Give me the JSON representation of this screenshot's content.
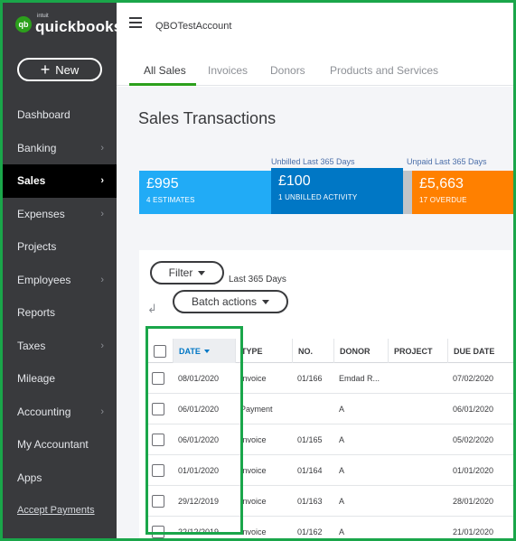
{
  "logo": {
    "mark": "qb",
    "small": "intuit",
    "name": "quickbooks"
  },
  "new_button": {
    "plus": "+",
    "label": "New"
  },
  "nav": [
    {
      "label": "Dashboard",
      "chevron": false,
      "active": false
    },
    {
      "label": "Banking",
      "chevron": true,
      "active": false
    },
    {
      "label": "Sales",
      "chevron": true,
      "active": true
    },
    {
      "label": "Expenses",
      "chevron": true,
      "active": false
    },
    {
      "label": "Projects",
      "chevron": false,
      "active": false
    },
    {
      "label": "Employees",
      "chevron": true,
      "active": false
    },
    {
      "label": "Reports",
      "chevron": false,
      "active": false
    },
    {
      "label": "Taxes",
      "chevron": true,
      "active": false
    },
    {
      "label": "Mileage",
      "chevron": false,
      "active": false
    },
    {
      "label": "Accounting",
      "chevron": true,
      "active": false
    },
    {
      "label": "My Accountant",
      "chevron": false,
      "active": false
    },
    {
      "label": "Apps",
      "chevron": false,
      "active": false
    },
    {
      "label": "Accept Payments",
      "chevron": false,
      "active": false,
      "link": true
    }
  ],
  "chevron_glyph": "›",
  "header": {
    "company": "QBOTestAccount"
  },
  "tabs": [
    {
      "label": "All Sales",
      "active": true
    },
    {
      "label": "Invoices",
      "active": false
    },
    {
      "label": "Donors",
      "active": false
    },
    {
      "label": "Products and Services",
      "active": false
    }
  ],
  "page_title": "Sales Transactions",
  "money_bar": {
    "unbilled_caption": "Unbilled Last 365 Days",
    "unpaid_caption": "Unpaid Last 365 Days",
    "estimates": {
      "amount": "£995",
      "label": "4 ESTIMATES",
      "color": "#21abf6"
    },
    "unbilled": {
      "amount": "£100",
      "label": "1 UNBILLED ACTIVITY",
      "color": "#0077c5"
    },
    "overdue": {
      "amount": "£5,663",
      "label": "17 OVERDUE",
      "color": "#ff8000"
    }
  },
  "filter": {
    "label": "Filter",
    "range": "Last 365 Days"
  },
  "batch_actions": {
    "label": "Batch actions"
  },
  "table": {
    "columns": [
      "DATE",
      "TYPE",
      "NO.",
      "DONOR",
      "PROJECT",
      "DUE DATE"
    ],
    "rows": [
      {
        "date": "08/01/2020",
        "type": "Invoice",
        "no": "01/166",
        "donor": "Emdad R...",
        "project": "",
        "due": "07/02/2020"
      },
      {
        "date": "06/01/2020",
        "type": "Payment",
        "no": "",
        "donor": "A",
        "project": "",
        "due": "06/01/2020"
      },
      {
        "date": "06/01/2020",
        "type": "Invoice",
        "no": "01/165",
        "donor": "A",
        "project": "",
        "due": "05/02/2020"
      },
      {
        "date": "01/01/2020",
        "type": "Invoice",
        "no": "01/164",
        "donor": "A",
        "project": "",
        "due": "01/01/2020"
      },
      {
        "date": "29/12/2019",
        "type": "Invoice",
        "no": "01/163",
        "donor": "A",
        "project": "",
        "due": "28/01/2020"
      },
      {
        "date": "22/12/2019",
        "type": "Invoice",
        "no": "01/162",
        "donor": "A",
        "project": "",
        "due": "21/01/2020"
      }
    ]
  }
}
